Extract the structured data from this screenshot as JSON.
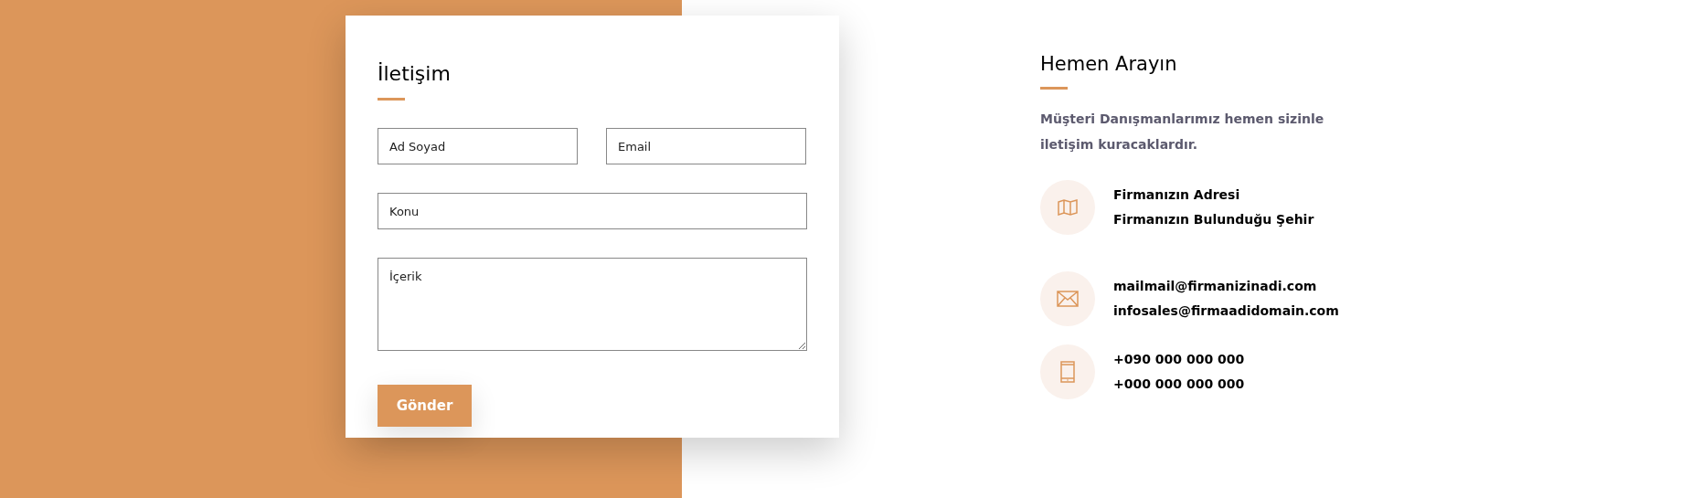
{
  "form": {
    "title": "İletişim",
    "fields": [
      {
        "kind": "input",
        "placeholder": "Ad Soyad"
      },
      {
        "kind": "input",
        "placeholder": "Email"
      },
      {
        "kind": "input",
        "placeholder": "Konu"
      },
      {
        "kind": "textarea",
        "placeholder": "İçerik"
      }
    ],
    "submit": "Gönder"
  },
  "contact": {
    "title": "Hemen Arayın",
    "text": "Müşteri Danışmanlarımız hemen sizinle iletişim kuracaklardır.",
    "items": [
      {
        "kind": "map",
        "lines": [
          "Firmanızın Adresi",
          "Firmanızın Bulunduğu Şehir"
        ]
      },
      {
        "kind": "mail",
        "lines": [
          "mailmail@firmanizinadi.com",
          "infosales@firmaadidomain.com"
        ]
      },
      {
        "kind": "phone",
        "lines": [
          "+090 000 000 000",
          "+000 000 000 000"
        ]
      }
    ]
  }
}
